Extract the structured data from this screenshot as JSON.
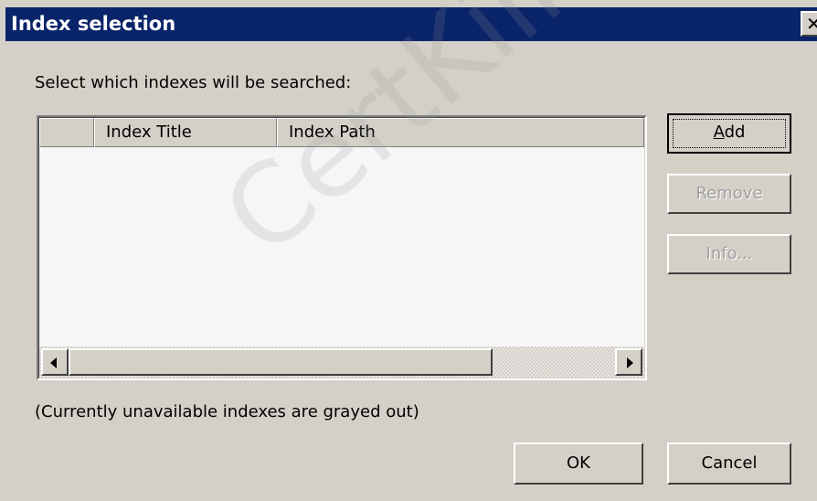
{
  "window": {
    "title": "Index selection",
    "close_glyph": "✕"
  },
  "prompt": "Select which indexes will be searched:",
  "list": {
    "columns": [
      "",
      "Index Title",
      "Index Path"
    ],
    "rows": []
  },
  "buttons": {
    "add": {
      "before": "",
      "mnemonic": "A",
      "after": "dd",
      "enabled": true
    },
    "remove": {
      "label": "Remove",
      "enabled": false
    },
    "info": {
      "label": "Info...",
      "enabled": false
    },
    "ok": "OK",
    "cancel": "Cancel"
  },
  "note": "(Currently unavailable indexes are grayed out)",
  "watermark": "CertKillere",
  "colors": {
    "titlebar": "#0a246a",
    "dialog_bg": "#d4d0c8",
    "disabled_text": "#a0a0a0"
  }
}
